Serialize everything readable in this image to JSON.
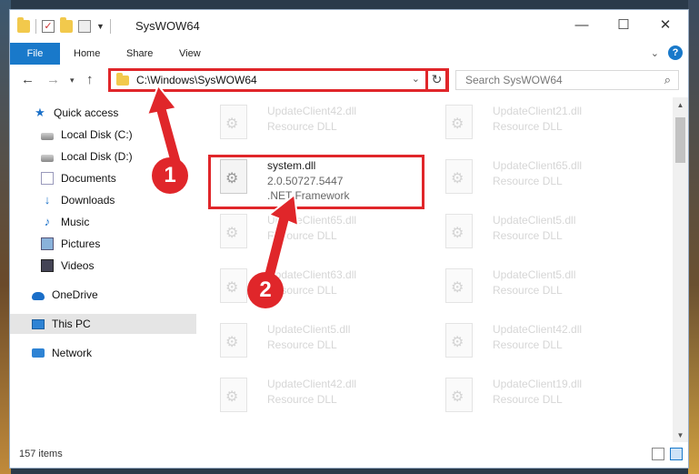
{
  "window": {
    "title": "SysWOW64",
    "controls": {
      "minimize": "—",
      "maximize": "☐",
      "close": "✕"
    }
  },
  "ribbon": {
    "tabs": [
      "File",
      "Home",
      "Share",
      "View"
    ]
  },
  "nav": {
    "address": "C:\\Windows\\SysWOW64",
    "search_placeholder": "Search SysWOW64"
  },
  "sidebar": {
    "items": [
      {
        "label": "Quick access",
        "icon": "star-icon"
      },
      {
        "label": "Local Disk (C:)",
        "icon": "drive-icon"
      },
      {
        "label": "Local Disk (D:)",
        "icon": "drive-icon"
      },
      {
        "label": "Documents",
        "icon": "documents-icon"
      },
      {
        "label": "Downloads",
        "icon": "downloads-icon"
      },
      {
        "label": "Music",
        "icon": "music-icon"
      },
      {
        "label": "Pictures",
        "icon": "pictures-icon"
      },
      {
        "label": "Videos",
        "icon": "videos-icon"
      },
      {
        "label": "OneDrive",
        "icon": "onedrive-icon"
      },
      {
        "label": "This PC",
        "icon": "this-pc-icon"
      },
      {
        "label": "Network",
        "icon": "network-icon"
      }
    ]
  },
  "files": [
    {
      "name": "UpdateClient42.dll",
      "type": "Resource DLL"
    },
    {
      "name": "UpdateClient21.dll",
      "type": "Resource DLL"
    },
    {
      "name": "system.dll",
      "version": "2.0.50727.5447",
      "type": ".NET Framework"
    },
    {
      "name": "UpdateClient65.dll",
      "type": "Resource DLL"
    },
    {
      "name": "UpdateClient65.dll",
      "type": "Resource DLL"
    },
    {
      "name": "UpdateClient5.dll",
      "type": "Resource DLL"
    },
    {
      "name": "UpdateClient63.dll",
      "type": "Resource DLL"
    },
    {
      "name": "UpdateClient5.dll",
      "type": "Resource DLL"
    },
    {
      "name": "UpdateClient5.dll",
      "type": "Resource DLL"
    },
    {
      "name": "UpdateClient42.dll",
      "type": "Resource DLL"
    },
    {
      "name": "UpdateClient42.dll",
      "type": "Resource DLL"
    },
    {
      "name": "UpdateClient19.dll",
      "type": "Resource DLL"
    }
  ],
  "status": {
    "items": "157 items"
  },
  "callouts": {
    "one": "1",
    "two": "2"
  },
  "colors": {
    "accent": "#1979ca",
    "highlight": "#e0262a"
  }
}
